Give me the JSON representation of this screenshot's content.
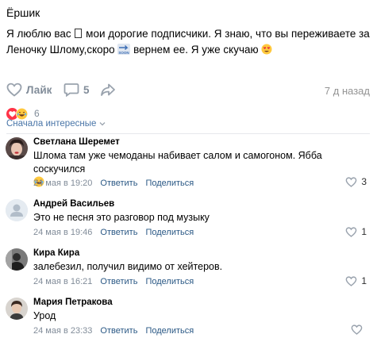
{
  "post": {
    "author": "Ёршик",
    "text_part1": "Я люблю вас ",
    "text_part2": " мои дорогие подписчики. Я знаю, что вы переживаете за Леночку Шломy,скоро ",
    "text_part3": " вернем ее. Я уже скучаю ",
    "soon_icon": "soon-arrow-icon",
    "heart_eyes_icon": "heart-eyes-emoji-icon"
  },
  "actions": {
    "like_label": "Лайк",
    "comments_count": "5",
    "time_ago": "7 д назад"
  },
  "reactions": {
    "count": "6",
    "icons": [
      "heart-reaction-icon",
      "laugh-reaction-icon"
    ],
    "colors": {
      "heart": "#ff3347",
      "laugh": "#ffc107"
    }
  },
  "sort": {
    "label": "Сначала интересные"
  },
  "comments": [
    {
      "name": "Светлана Шеремет",
      "text": "Шлома там уже чемоданы набивает салом и самогоном. Ябба соскучился",
      "date": "24 мая в 19:20",
      "reply": "Ответить",
      "share": "Поделиться",
      "likes": "3"
    },
    {
      "name": "Андрей Васильев",
      "text": "Это не песня это разговор под музыку",
      "date": "24 мая в 19:46",
      "reply": "Ответить",
      "share": "Поделиться",
      "likes": "1"
    },
    {
      "name": "Кира Кира",
      "text": "залебезил, получил видимо от хейтеров.",
      "date": "24 мая в 16:21",
      "reply": "Ответить",
      "share": "Поделиться",
      "likes": "1"
    },
    {
      "name": "Мария Петракова",
      "text": "Урод",
      "date": "24 мая в 23:33",
      "reply": "Ответить",
      "share": "Поделиться",
      "likes": ""
    }
  ],
  "colors": {
    "accent": "#2a5885",
    "muted": "#818c99"
  }
}
